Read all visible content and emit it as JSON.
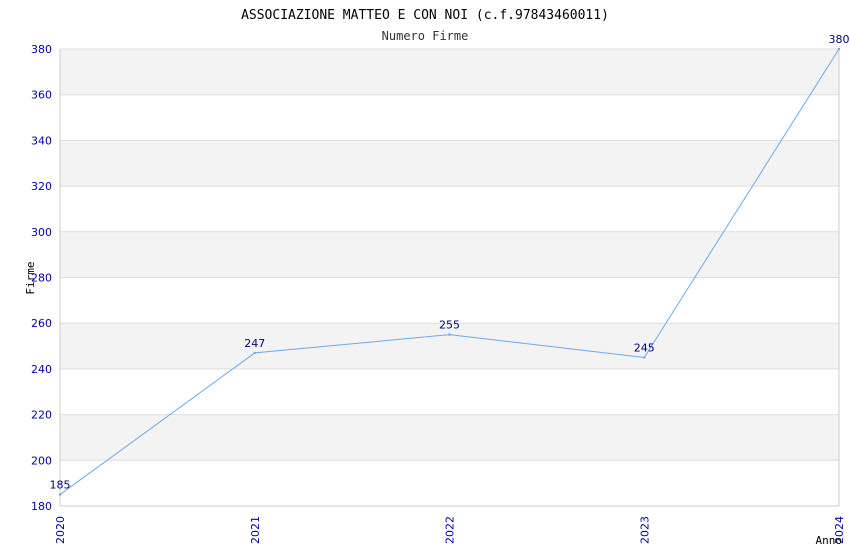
{
  "chart_data": {
    "type": "line",
    "title": "ASSOCIAZIONE MATTEO E CON NOI (c.f.97843460011)",
    "subtitle": "Numero Firme",
    "xlabel": "Anno",
    "ylabel": "Firme",
    "x": [
      "2020",
      "2021",
      "2022",
      "2023",
      "2024"
    ],
    "series": [
      {
        "values": [
          185,
          247,
          255,
          245,
          380
        ]
      }
    ],
    "ylim": [
      180,
      380
    ],
    "yticks": [
      180,
      200,
      220,
      240,
      260,
      280,
      300,
      320,
      340,
      360,
      380
    ],
    "grid": true,
    "colors": {
      "line": "#6aa9ee",
      "tick_labels": "#0000aa",
      "data_labels": "#000080",
      "band": "#f3f3f3",
      "gridline": "#dddddd"
    }
  }
}
